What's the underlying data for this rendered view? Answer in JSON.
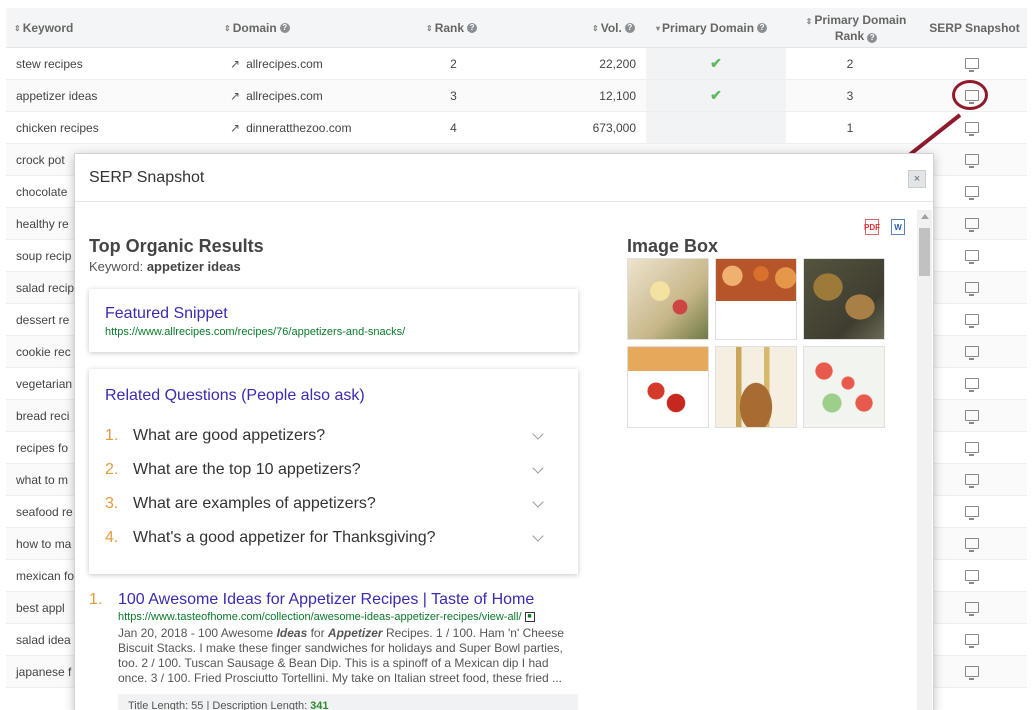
{
  "table": {
    "headers": {
      "keyword": "Keyword",
      "domain": "Domain",
      "rank": "Rank",
      "vol": "Vol.",
      "primary_domain": "Primary Domain",
      "primary_domain_rank_1": "Primary Domain",
      "primary_domain_rank_2": "Rank",
      "serp_snapshot": "SERP Snapshot"
    },
    "rows": [
      {
        "keyword": "stew recipes",
        "domain": "allrecipes.com",
        "rank": "2",
        "vol": "22,200",
        "primary": true,
        "pd_rank": "2"
      },
      {
        "keyword": "appetizer ideas",
        "domain": "allrecipes.com",
        "rank": "3",
        "vol": "12,100",
        "primary": true,
        "pd_rank": "3"
      },
      {
        "keyword": "chicken recipes",
        "domain": "dinneratthezoo.com",
        "rank": "4",
        "vol": "673,000",
        "primary": false,
        "pd_rank": "1"
      },
      {
        "keyword": "crock pot"
      },
      {
        "keyword": "chocolate"
      },
      {
        "keyword": "healthy re"
      },
      {
        "keyword": "soup recip"
      },
      {
        "keyword": "salad recip"
      },
      {
        "keyword": "dessert re"
      },
      {
        "keyword": "cookie rec"
      },
      {
        "keyword": "vegetarian"
      },
      {
        "keyword": "bread reci"
      },
      {
        "keyword": "recipes fo"
      },
      {
        "keyword": "what to m"
      },
      {
        "keyword": "seafood re"
      },
      {
        "keyword": "how to ma"
      },
      {
        "keyword": "mexican fo"
      },
      {
        "keyword": "best appl"
      },
      {
        "keyword": "salad idea"
      },
      {
        "keyword": "japanese f"
      }
    ]
  },
  "modal": {
    "title": "SERP Snapshot",
    "close": "×",
    "top_organic_title": "Top Organic Results",
    "keyword_label": "Keyword:",
    "keyword_value": "appetizer ideas",
    "featured_snippet": {
      "title": "Featured Snippet",
      "url": "https://www.allrecipes.com/recipes/76/appetizers-and-snacks/"
    },
    "related_questions": {
      "title": "Related Questions (People also ask)",
      "items": [
        {
          "num": "1.",
          "text": "What are good appetizers?"
        },
        {
          "num": "2.",
          "text": "What are the top 10 appetizers?"
        },
        {
          "num": "3.",
          "text": "What are examples of appetizers?"
        },
        {
          "num": "4.",
          "text": "What's a good appetizer for Thanksgiving?"
        }
      ]
    },
    "organic": {
      "num": "1.",
      "title": "100 Awesome Ideas for Appetizer Recipes | Taste of Home",
      "url": "https://www.tasteofhome.com/collection/awesome-ideas-appetizer-recipes/view-all/",
      "desc_date": "Jan 20, 2018 - 100 Awesome ",
      "desc_b1": "Ideas",
      "desc_mid": " for ",
      "desc_b2": "Appetizer",
      "desc_rest": " Recipes. 1 / 100. Ham 'n' Cheese Biscuit Stacks. I make these finger sandwiches for holidays and Super Bowl parties, too. 2 / 100. Tuscan Sausage & Bean Dip. This is a spinoff of a Mexican dip I had once. 3 / 100. Fried Prosciutto Tortellini. My take on Italian street food, these fried ...",
      "stats_label": "Title Length: 55 | Description Length:",
      "desc_length": "341"
    },
    "image_box_title": "Image Box",
    "pdf_icon": "PDF",
    "word_icon": "W"
  },
  "colors": {
    "accent_link": "#3a2bb0",
    "url_green": "#0a7a2a",
    "number_orange": "#e39b3d",
    "annotation": "#8e1a2c",
    "check": "#5cb85c"
  }
}
